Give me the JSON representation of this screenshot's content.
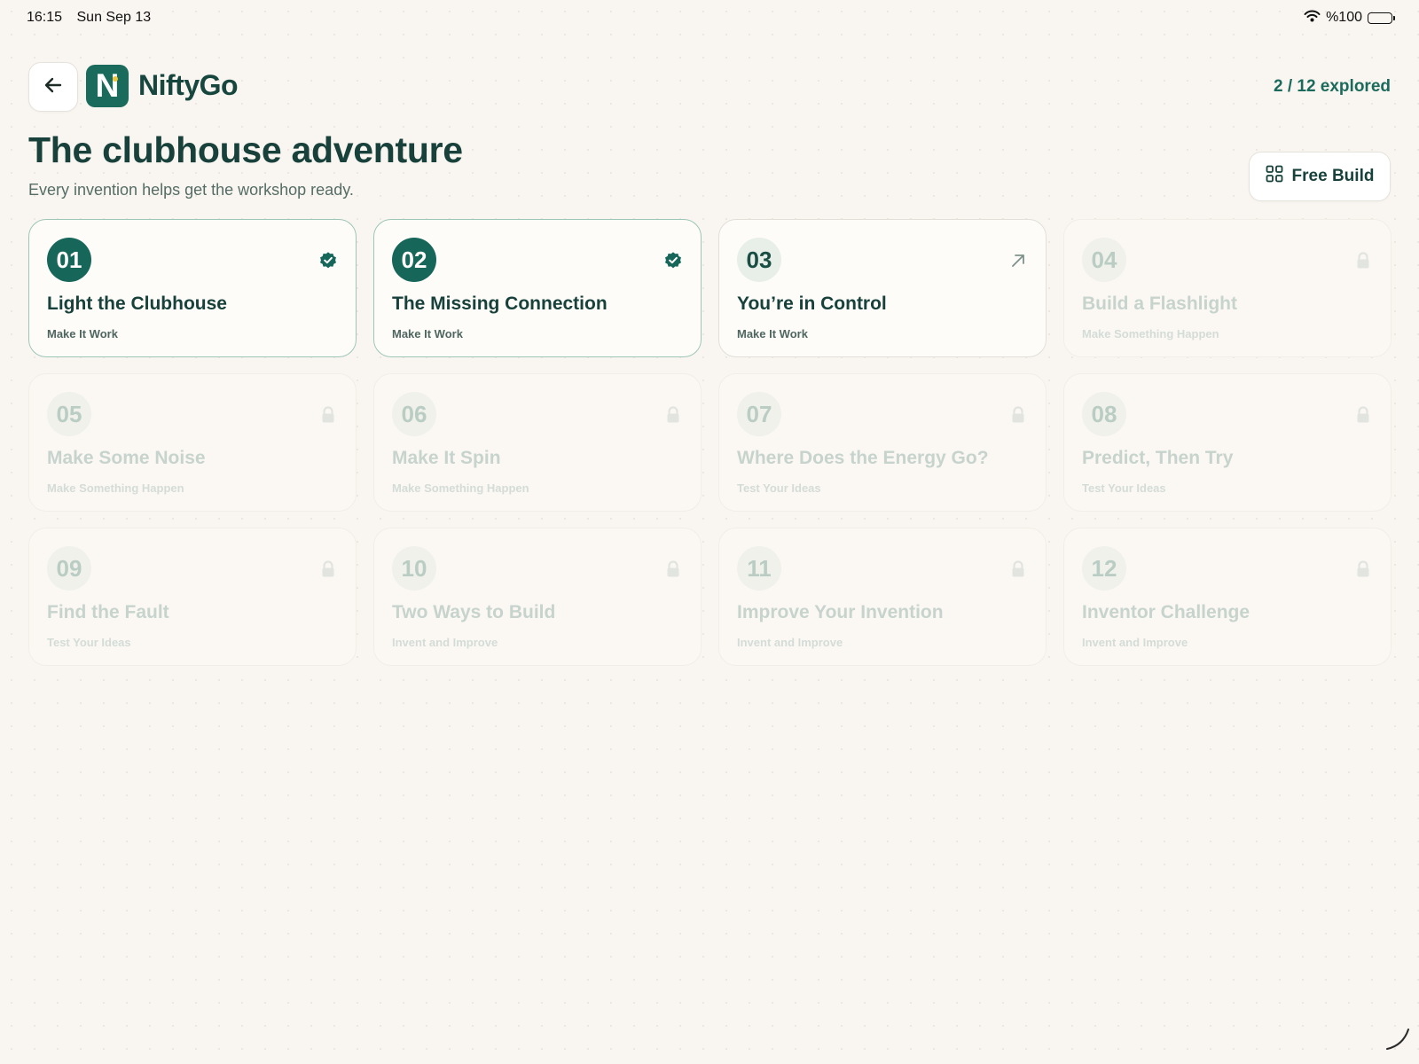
{
  "status_bar": {
    "time": "16:15",
    "date": "Sun Sep 13",
    "battery": "%100"
  },
  "header": {
    "logo_letter": "N",
    "brand": "NiftyGo",
    "progress": "2 / 12 explored"
  },
  "page": {
    "title": "The clubhouse adventure",
    "subtitle": "Every invention helps get the workshop ready."
  },
  "free_build": {
    "label": "Free Build"
  },
  "colors": {
    "brand": "#1b6b5c",
    "accent_dot": "#f2c43b",
    "background": "#f9f5f0",
    "heading": "#17413a"
  },
  "cards": [
    {
      "number": "01",
      "title": "Light the Clubhouse",
      "category": "Make It Work",
      "state": "completed",
      "icon": "check-badge-icon"
    },
    {
      "number": "02",
      "title": "The Missing Connection",
      "category": "Make It Work",
      "state": "completed",
      "icon": "check-badge-icon"
    },
    {
      "number": "03",
      "title": "You’re in Control",
      "category": "Make It Work",
      "state": "available",
      "icon": "arrow-up-right-icon"
    },
    {
      "number": "04",
      "title": "Build a Flashlight",
      "category": "Make Something Happen",
      "state": "locked",
      "icon": "lock-icon"
    },
    {
      "number": "05",
      "title": "Make Some Noise",
      "category": "Make Something Happen",
      "state": "locked",
      "icon": "lock-icon"
    },
    {
      "number": "06",
      "title": "Make It Spin",
      "category": "Make Something Happen",
      "state": "locked",
      "icon": "lock-icon"
    },
    {
      "number": "07",
      "title": "Where Does the Energy Go?",
      "category": "Test Your Ideas",
      "state": "locked",
      "icon": "lock-icon"
    },
    {
      "number": "08",
      "title": "Predict, Then Try",
      "category": "Test Your Ideas",
      "state": "locked",
      "icon": "lock-icon"
    },
    {
      "number": "09",
      "title": "Find the Fault",
      "category": "Test Your Ideas",
      "state": "locked",
      "icon": "lock-icon"
    },
    {
      "number": "10",
      "title": "Two Ways to Build",
      "category": "Invent and Improve",
      "state": "locked",
      "icon": "lock-icon"
    },
    {
      "number": "11",
      "title": "Improve Your Invention",
      "category": "Invent and Improve",
      "state": "locked",
      "icon": "lock-icon"
    },
    {
      "number": "12",
      "title": "Inventor Challenge",
      "category": "Invent and Improve",
      "state": "locked",
      "icon": "lock-icon"
    }
  ]
}
